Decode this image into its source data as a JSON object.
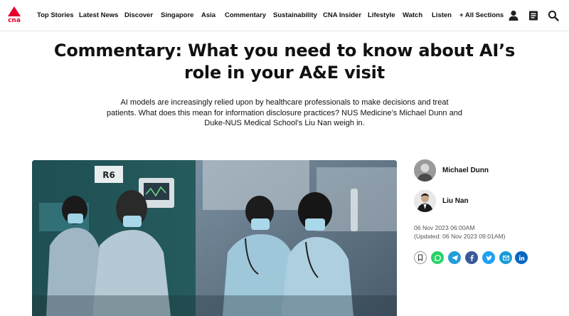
{
  "brand": {
    "logo_text": "cna"
  },
  "nav": {
    "items": [
      "Top Stories",
      "Latest News",
      "Discover",
      "Singapore",
      "Asia",
      "Commentary",
      "Sustainability",
      "CNA Insider",
      "Lifestyle",
      "Watch",
      "Listen",
      "+ All Sections"
    ],
    "icons": [
      "user-icon",
      "menu-icon",
      "search-icon"
    ]
  },
  "article": {
    "headline": "Commentary: What you need to know about AI’s role in your A&E visit",
    "dek": "AI models are increasingly relied upon by healthcare professionals to make decisions and treat patients. What does this mean for information disclosure practices? NUS Medicine’s Michael Dunn and Duke-NUS Medical School’s Liu Nan weigh in.",
    "hero_image_sign": "R6",
    "authors": [
      {
        "name": "Michael Dunn"
      },
      {
        "name": "Liu Nan"
      }
    ],
    "published": "06 Nov 2023 06:00AM",
    "updated": "(Updated: 06 Nov 2023 09:01AM)"
  },
  "share": {
    "icons": [
      "bookmark-icon",
      "whatsapp-icon",
      "telegram-icon",
      "facebook-icon",
      "twitter-icon",
      "email-icon",
      "linkedin-icon"
    ],
    "colors": {
      "whatsapp": "#25d366",
      "telegram": "#229ed9",
      "facebook": "#3b5998",
      "twitter": "#1da1f2",
      "email": "#1a9bd7",
      "linkedin": "#0a66c2"
    }
  },
  "theme": {
    "accent": "#e4002b"
  }
}
